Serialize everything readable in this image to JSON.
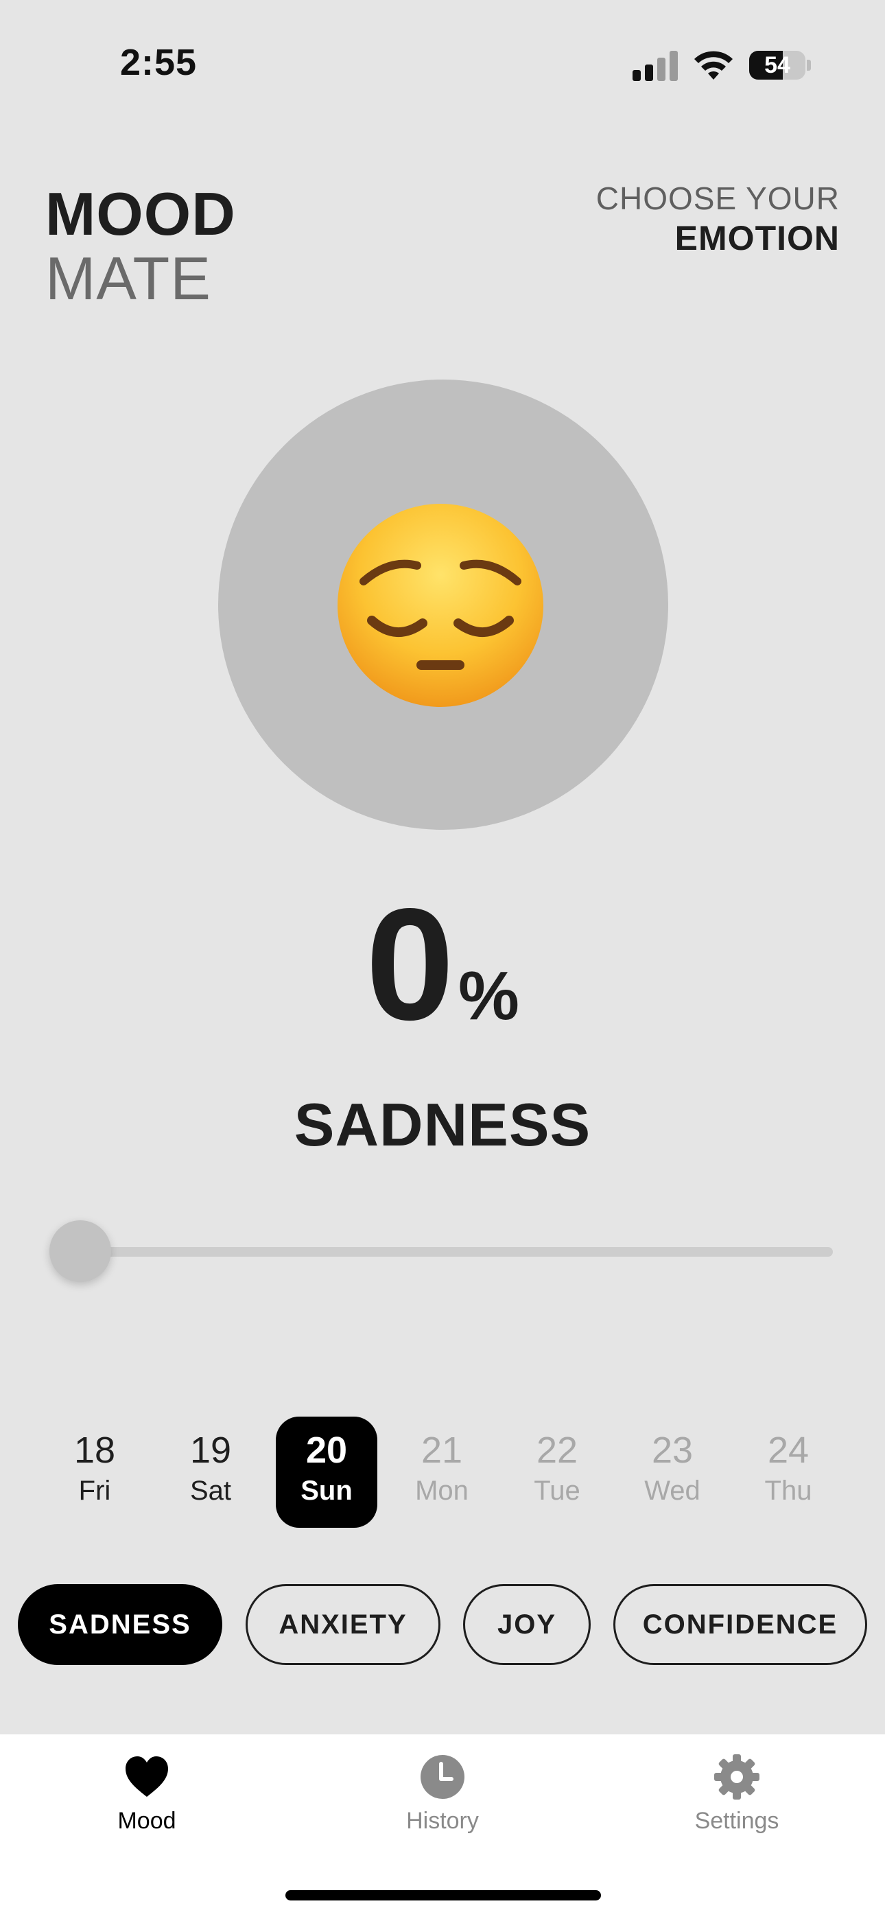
{
  "status_bar": {
    "time": "2:55",
    "battery": "54"
  },
  "header": {
    "logo_line1": "MOOD",
    "logo_line2": "MATE",
    "prompt_line1": "CHOOSE YOUR",
    "prompt_line2": "EMOTION"
  },
  "mood": {
    "emoji_icon": "pensive-face-icon",
    "percent_value": "0",
    "percent_sign": "%",
    "emotion_name": "SADNESS",
    "slider_value_percent": 0,
    "circle_color": "#bfbfbf"
  },
  "dates": [
    {
      "day": "18",
      "weekday": "Fri",
      "state": "past"
    },
    {
      "day": "19",
      "weekday": "Sat",
      "state": "past"
    },
    {
      "day": "20",
      "weekday": "Sun",
      "state": "selected"
    },
    {
      "day": "21",
      "weekday": "Mon",
      "state": "future"
    },
    {
      "day": "22",
      "weekday": "Tue",
      "state": "future"
    },
    {
      "day": "23",
      "weekday": "Wed",
      "state": "future"
    },
    {
      "day": "24",
      "weekday": "Thu",
      "state": "future"
    }
  ],
  "emotions": [
    {
      "label": "SADNESS",
      "selected": true
    },
    {
      "label": "ANXIETY",
      "selected": false
    },
    {
      "label": "JOY",
      "selected": false
    },
    {
      "label": "CONFIDENCE",
      "selected": false
    }
  ],
  "tabs": [
    {
      "label": "Mood",
      "icon": "heart-icon",
      "active": true
    },
    {
      "label": "History",
      "icon": "clock-icon",
      "active": false
    },
    {
      "label": "Settings",
      "icon": "gear-icon",
      "active": false
    }
  ],
  "colors": {
    "background": "#e5e5e5",
    "accent": "#000000",
    "inactive": "#8a8a8a"
  }
}
